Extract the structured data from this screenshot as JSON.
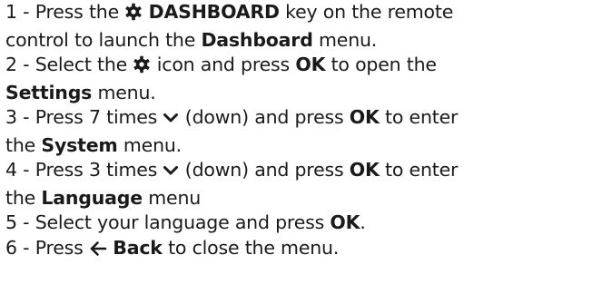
{
  "instructions": {
    "step1": {
      "num": "1 -",
      "pre": "Press the",
      "key": "DASHBOARD",
      "post": "key on the remote",
      "cont_pre": "control to launch the",
      "menu": "Dashboard",
      "cont_post": "menu.",
      "icon": "gear-icon"
    },
    "step2": {
      "num": "2 -",
      "pre": "Select the",
      "mid": "icon and press",
      "ok": "OK",
      "post": "to open the",
      "menu": "Settings",
      "cont_post": "menu.",
      "icon": "gear-icon"
    },
    "step3": {
      "num": "3 -",
      "pre": "Press 7 times",
      "dir": "(down) and press",
      "ok": "OK",
      "post": "to enter",
      "cont_pre": "the",
      "menu": "System",
      "cont_post": "menu.",
      "icon": "chevron-down-icon"
    },
    "step4": {
      "num": "4 -",
      "pre": "Press 3 times",
      "dir": "(down) and press",
      "ok": "OK",
      "post": "to enter",
      "cont_pre": "the",
      "menu": "Language",
      "cont_post": "menu",
      "icon": "chevron-down-icon"
    },
    "step5": {
      "num": "5 -",
      "pre": "Select your language and press",
      "ok": "OK",
      "post": "."
    },
    "step6": {
      "num": "6 -",
      "pre": "Press",
      "key": "Back",
      "post": "to close the menu.",
      "icon": "arrow-left-icon"
    }
  }
}
